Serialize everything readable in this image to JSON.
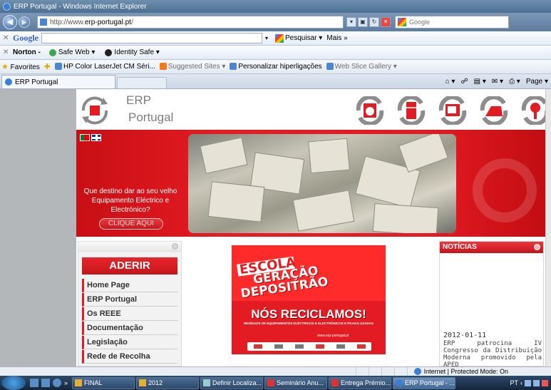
{
  "window": {
    "title": "ERP Portugal - Windows Internet Explorer"
  },
  "address": {
    "url_prefix": "http://www.",
    "url_domain": "erp-portugal.pt",
    "url_suffix": "/",
    "search_placeholder": "Google"
  },
  "google_toolbar": {
    "logo": "Google",
    "search_label": "Pesquisar",
    "more_label": "Mais »"
  },
  "norton_toolbar": {
    "brand": "Norton -",
    "safe_web": "Safe Web ▾",
    "identity_safe": "Identity Safe ▾"
  },
  "favorites_bar": {
    "favorites_label": "Favorites",
    "items": [
      "HP Color LaserJet CM Séri...",
      "Suggested Sites ▾",
      "Personalizar hiperligações",
      "Web Slice Gallery ▾"
    ]
  },
  "tabs": {
    "active": "ERP Portugal",
    "page_menu": "Page ▾"
  },
  "site": {
    "logo_line1": "ERP",
    "logo_line2": "Portugal",
    "banner_question": "Que destino dar ao seu velho Equipamento Eléctrico e Electrónico?",
    "banner_button": "CLIQUE AQUI",
    "aderir": "ADERIR",
    "menu": [
      "Home Page",
      "ERP Portugal",
      "Os REEE",
      "Documentação",
      "Legislação",
      "Rede de Recolha"
    ],
    "promo": {
      "line1": "ESCOLA",
      "line2": "GERAÇÃO",
      "line3": "DEPOSITRÃO",
      "headline": "NÓS RECICLAMOS!",
      "subline": "RESÍDUOS DE EQUIPAMENTOS ELÉCTRICOS E ELECTRÓNICOS E PILHAS USADAS",
      "url": "www.erp-portugal.pt"
    },
    "news": {
      "heading": "NOTÍCIAS",
      "date": "2012-01-11",
      "text": "ERP patrocina IV Congresso da Distribuição Moderna promovido pela APED"
    }
  },
  "status": {
    "zone": "Internet | Protected Mode: On"
  },
  "taskbar": {
    "tasks": [
      "FINAL",
      "2012",
      "Definir Localiza...",
      "Seminário Anu...",
      "Entrega Prémio...",
      "ERP Portugal - ..."
    ],
    "language": "PT"
  },
  "colors": {
    "brand_red": "#e31b22",
    "title_blue": "#4c6f93"
  }
}
